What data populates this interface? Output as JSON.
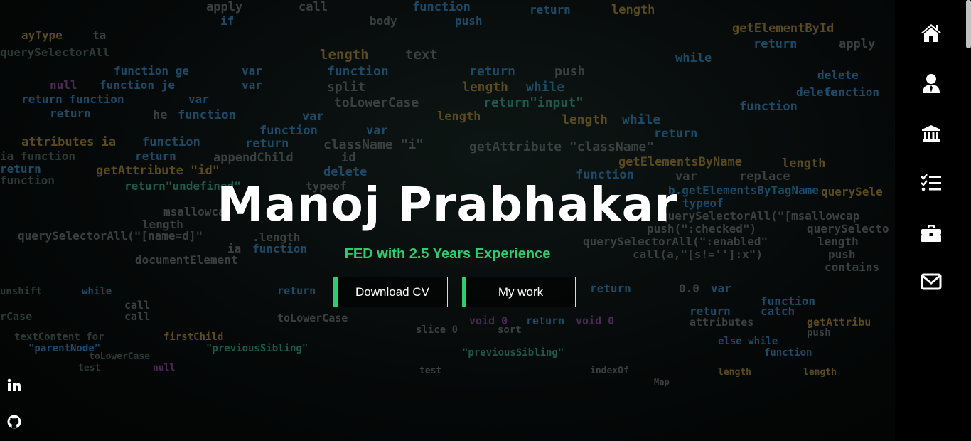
{
  "hero": {
    "name": "Manoj Prabhakar",
    "tagline": "FED with 2.5 Years Experience",
    "buttons": {
      "download_cv": "Download CV",
      "my_work": "My work"
    }
  },
  "nav": {
    "items": [
      {
        "icon": "home-icon"
      },
      {
        "icon": "user-icon"
      },
      {
        "icon": "institution-icon"
      },
      {
        "icon": "task-list-icon"
      },
      {
        "icon": "briefcase-icon"
      },
      {
        "icon": "envelope-icon"
      }
    ]
  },
  "social": [
    {
      "icon": "linkedin-icon"
    },
    {
      "icon": "github-icon"
    }
  ],
  "colors": {
    "accent": "#2ecc71",
    "background": "#000000",
    "text": "#ffffff"
  }
}
